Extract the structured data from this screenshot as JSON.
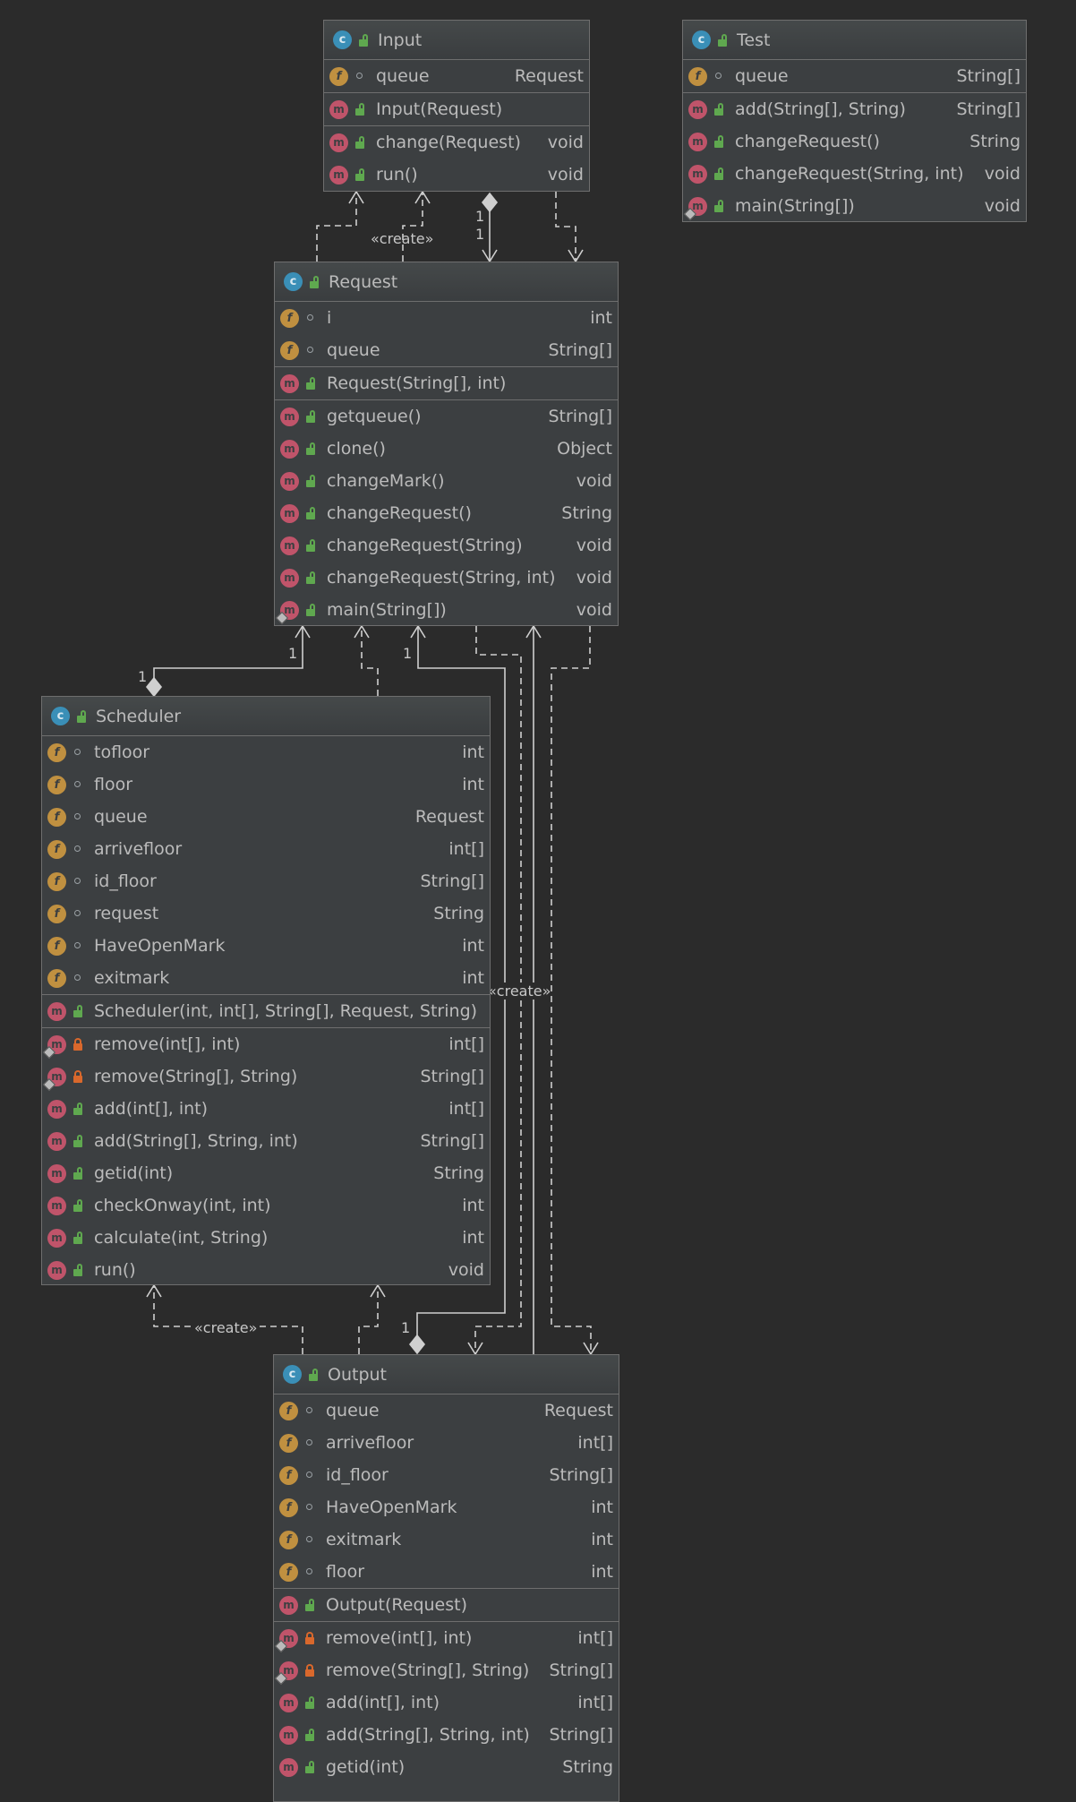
{
  "labels": {
    "create": "«create»",
    "one": "1"
  },
  "colors": {
    "background": "#2b2b2b",
    "box": "#3c3f41",
    "edge": "#cfcfcf"
  },
  "classes": {
    "input": {
      "name": "Input",
      "fields": [
        {
          "name": "queue",
          "type": "Request",
          "vis": "pkg"
        }
      ],
      "constructors": [
        {
          "name": "Input(Request)",
          "type": "",
          "vis": "pub"
        }
      ],
      "methods": [
        {
          "name": "change(Request)",
          "type": "void",
          "vis": "pub"
        },
        {
          "name": "run()",
          "type": "void",
          "vis": "pub"
        }
      ]
    },
    "test": {
      "name": "Test",
      "fields": [
        {
          "name": "queue",
          "type": "String[]",
          "vis": "pkg"
        }
      ],
      "constructors": [],
      "methods": [
        {
          "name": "add(String[], String)",
          "type": "String[]",
          "vis": "pub"
        },
        {
          "name": "changeRequest()",
          "type": "String",
          "vis": "pub"
        },
        {
          "name": "changeRequest(String, int)",
          "type": "void",
          "vis": "pub"
        },
        {
          "name": "main(String[])",
          "type": "void",
          "vis": "pub",
          "static": true
        }
      ]
    },
    "request": {
      "name": "Request",
      "fields": [
        {
          "name": "i",
          "type": "int",
          "vis": "pkg"
        },
        {
          "name": "queue",
          "type": "String[]",
          "vis": "pkg"
        }
      ],
      "constructors": [
        {
          "name": "Request(String[], int)",
          "type": "",
          "vis": "pub"
        }
      ],
      "methods": [
        {
          "name": "getqueue()",
          "type": "String[]",
          "vis": "pub"
        },
        {
          "name": "clone()",
          "type": "Object",
          "vis": "pub"
        },
        {
          "name": "changeMark()",
          "type": "void",
          "vis": "pub"
        },
        {
          "name": "changeRequest()",
          "type": "String",
          "vis": "pub"
        },
        {
          "name": "changeRequest(String)",
          "type": "void",
          "vis": "pub"
        },
        {
          "name": "changeRequest(String, int)",
          "type": "void",
          "vis": "pub"
        },
        {
          "name": "main(String[])",
          "type": "void",
          "vis": "pub",
          "static": true
        }
      ]
    },
    "scheduler": {
      "name": "Scheduler",
      "fields": [
        {
          "name": "tofloor",
          "type": "int",
          "vis": "pkg"
        },
        {
          "name": "floor",
          "type": "int",
          "vis": "pkg"
        },
        {
          "name": "queue",
          "type": "Request",
          "vis": "pkg"
        },
        {
          "name": "arrivefloor",
          "type": "int[]",
          "vis": "pkg"
        },
        {
          "name": "id_floor",
          "type": "String[]",
          "vis": "pkg"
        },
        {
          "name": "request",
          "type": "String",
          "vis": "pkg"
        },
        {
          "name": "HaveOpenMark",
          "type": "int",
          "vis": "pkg"
        },
        {
          "name": "exitmark",
          "type": "int",
          "vis": "pkg"
        }
      ],
      "constructors": [
        {
          "name": "Scheduler(int, int[], String[], Request, String)",
          "type": "",
          "vis": "pub"
        }
      ],
      "methods": [
        {
          "name": "remove(int[], int)",
          "type": "int[]",
          "vis": "priv",
          "static": true
        },
        {
          "name": "remove(String[], String)",
          "type": "String[]",
          "vis": "priv",
          "static": true
        },
        {
          "name": "add(int[], int)",
          "type": "int[]",
          "vis": "pub"
        },
        {
          "name": "add(String[], String, int)",
          "type": "String[]",
          "vis": "pub"
        },
        {
          "name": "getid(int)",
          "type": "String",
          "vis": "pub"
        },
        {
          "name": "checkOnway(int, int)",
          "type": "int",
          "vis": "pub"
        },
        {
          "name": "calculate(int, String)",
          "type": "int",
          "vis": "pub"
        },
        {
          "name": "run()",
          "type": "void",
          "vis": "pub"
        }
      ]
    },
    "output": {
      "name": "Output",
      "fields": [
        {
          "name": "queue",
          "type": "Request",
          "vis": "pkg"
        },
        {
          "name": "arrivefloor",
          "type": "int[]",
          "vis": "pkg"
        },
        {
          "name": "id_floor",
          "type": "String[]",
          "vis": "pkg"
        },
        {
          "name": "HaveOpenMark",
          "type": "int",
          "vis": "pkg"
        },
        {
          "name": "exitmark",
          "type": "int",
          "vis": "pkg"
        },
        {
          "name": "floor",
          "type": "int",
          "vis": "pkg"
        }
      ],
      "constructors": [
        {
          "name": "Output(Request)",
          "type": "",
          "vis": "pub"
        }
      ],
      "methods": [
        {
          "name": "remove(int[], int)",
          "type": "int[]",
          "vis": "priv",
          "static": true
        },
        {
          "name": "remove(String[], String)",
          "type": "String[]",
          "vis": "priv",
          "static": true
        },
        {
          "name": "add(int[], int)",
          "type": "int[]",
          "vis": "pub"
        },
        {
          "name": "add(String[], String, int)",
          "type": "String[]",
          "vis": "pub"
        },
        {
          "name": "getid(int)",
          "type": "String",
          "vis": "pub"
        }
      ]
    }
  }
}
